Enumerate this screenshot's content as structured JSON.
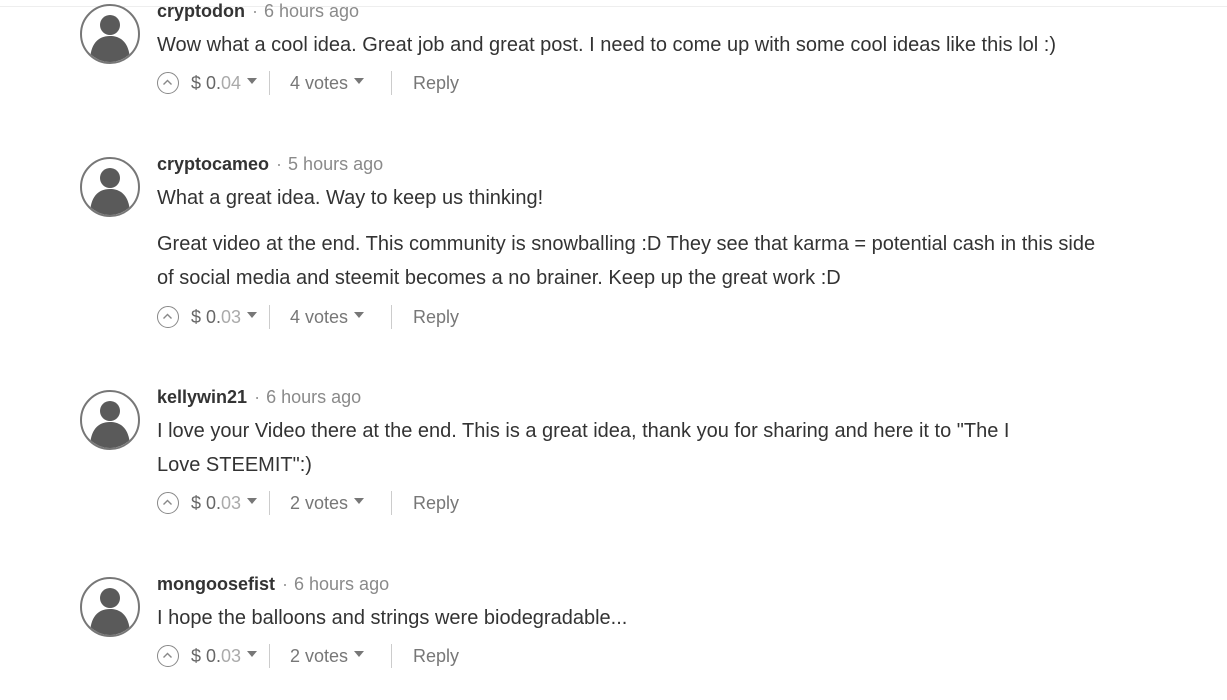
{
  "comments": [
    {
      "author": "cryptodon",
      "separator": "·",
      "time": "6 hours ago",
      "paragraphs": [
        "Wow what a cool idea. Great job and great post. I need to come up with some cool ideas like this lol :)"
      ],
      "payout_int": "$ 0.",
      "payout_dec": "04",
      "votes": "4 votes",
      "reply": "Reply"
    },
    {
      "author": "cryptocameo",
      "separator": "·",
      "time": "5 hours ago",
      "paragraphs": [
        "What a great idea. Way to keep us thinking!",
        "Great video at the end. This community is snowballing :D They see that karma = potential cash in this side of social media and steemit becomes a no brainer. Keep up the great work :D"
      ],
      "payout_int": "$ 0.",
      "payout_dec": "03",
      "votes": "4 votes",
      "reply": "Reply"
    },
    {
      "author": "kellywin21",
      "separator": "·",
      "time": "6 hours ago",
      "paragraphs": [
        "I love your Video there at the end. This is a great idea, thank you for sharing and here it to \"The I Love STEEMIT\":)"
      ],
      "payout_int": "$ 0.",
      "payout_dec": "03",
      "votes": "2 votes",
      "reply": "Reply"
    },
    {
      "author": "mongoosefist",
      "separator": "·",
      "time": "6 hours ago",
      "paragraphs": [
        "I hope the balloons and strings were biodegradable..."
      ],
      "payout_int": "$ 0.",
      "payout_dec": "03",
      "votes": "2 votes",
      "reply": "Reply"
    }
  ]
}
